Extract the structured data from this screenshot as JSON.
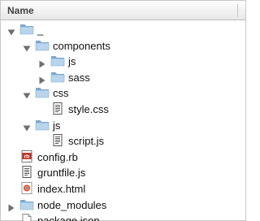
{
  "header": {
    "name_label": "Name"
  },
  "tree": [
    {
      "label": "_",
      "kind": "folder",
      "depth": 0,
      "expanded": true,
      "icon": "folder-icon"
    },
    {
      "label": "components",
      "kind": "folder",
      "depth": 1,
      "expanded": true,
      "icon": "folder-icon"
    },
    {
      "label": "js",
      "kind": "folder",
      "depth": 2,
      "expanded": false,
      "icon": "folder-icon"
    },
    {
      "label": "sass",
      "kind": "folder",
      "depth": 2,
      "expanded": false,
      "icon": "folder-icon"
    },
    {
      "label": "css",
      "kind": "folder",
      "depth": 1,
      "expanded": true,
      "icon": "folder-icon"
    },
    {
      "label": "style.css",
      "kind": "file",
      "depth": 2,
      "icon": "text-file-icon"
    },
    {
      "label": "js",
      "kind": "folder",
      "depth": 1,
      "expanded": true,
      "icon": "folder-icon"
    },
    {
      "label": "script.js",
      "kind": "file",
      "depth": 2,
      "icon": "text-file-icon"
    },
    {
      "label": "config.rb",
      "kind": "file",
      "depth": 0,
      "icon": "ruby-file-icon"
    },
    {
      "label": "gruntfile.js",
      "kind": "file",
      "depth": 0,
      "icon": "text-file-icon"
    },
    {
      "label": "index.html",
      "kind": "file",
      "depth": 0,
      "icon": "html-file-icon"
    },
    {
      "label": "node_modules",
      "kind": "folder",
      "depth": 0,
      "expanded": false,
      "icon": "folder-icon"
    },
    {
      "label": "package.json",
      "kind": "file",
      "depth": 0,
      "icon": "blank-file-icon"
    }
  ],
  "colors": {
    "folder_light": "#b8d5ec",
    "folder_dark": "#7ba7ce",
    "triangle": "#6f6f6f",
    "ruby_red": "#c0392b",
    "chrome_ring": "#e0453a"
  }
}
